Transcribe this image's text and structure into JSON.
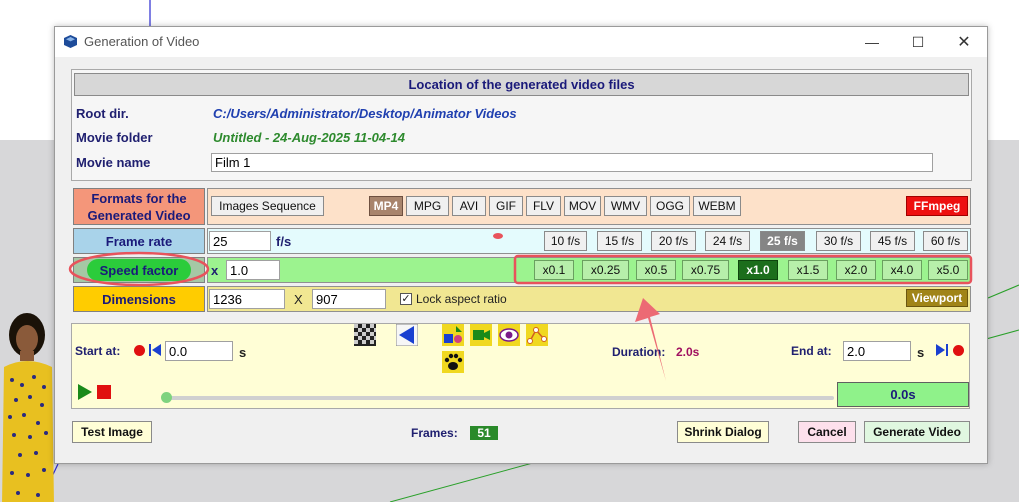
{
  "window": {
    "title": "Generation of Video"
  },
  "location": {
    "header": "Location of the generated video files",
    "root_label": "Root dir.",
    "root_value": "C:/Users/Administrator/Desktop/Animator Videos",
    "folder_label": "Movie folder",
    "folder_value": "Untitled - 24-Aug-2025 11-04-14",
    "name_label": "Movie name",
    "name_value": "Film 1"
  },
  "formats": {
    "label_line1": "Formats for the",
    "label_line2": "Generated Video",
    "images_sequence": "Images Sequence",
    "items": [
      "MP4",
      "MPG",
      "AVI",
      "GIF",
      "FLV",
      "MOV",
      "WMV",
      "OGG",
      "WEBM"
    ],
    "selected": "MP4",
    "ffmpeg": "FFmpeg"
  },
  "frame_rate": {
    "label": "Frame rate",
    "value": "25",
    "unit": "f/s",
    "options": [
      "10 f/s",
      "15 f/s",
      "20 f/s",
      "24 f/s",
      "25 f/s",
      "30 f/s",
      "45 f/s",
      "60 f/s"
    ],
    "selected": "25 f/s"
  },
  "speed": {
    "label": "Speed factor",
    "x": "x",
    "value": "1.0",
    "options": [
      "x0.1",
      "x0.25",
      "x0.5",
      "x0.75",
      "x1.0",
      "x1.5",
      "x2.0",
      "x4.0",
      "x5.0"
    ],
    "selected": "x1.0"
  },
  "dimensions": {
    "label": "Dimensions",
    "width": "1236",
    "x": "X",
    "height": "907",
    "lock_label": "Lock aspect ratio",
    "lock_checked": true,
    "viewport": "Viewport"
  },
  "playback": {
    "start_label": "Start at:",
    "start_value": "0.0",
    "start_unit": "s",
    "duration_label": "Duration:",
    "duration_value": "2.0s",
    "end_label": "End at:",
    "end_value": "2.0",
    "end_unit": "s",
    "current_time": "0.0s",
    "progress": 0
  },
  "footer": {
    "test_image": "Test Image",
    "frames_label": "Frames:",
    "frames_value": "51",
    "shrink": "Shrink Dialog",
    "cancel": "Cancel",
    "generate": "Generate Video"
  },
  "colors": {
    "formats_label": "#f4967a",
    "formats_body": "#fde1c9",
    "frame_label": "#a9d3ea",
    "frame_body": "#e4fbfd",
    "speed_body": "#9cf38f",
    "speed_selected": "#1c6e1c",
    "dimensions_label": "#ffcc00",
    "ffmpeg": "#ee1010",
    "annotation_red": "#e8535c"
  }
}
